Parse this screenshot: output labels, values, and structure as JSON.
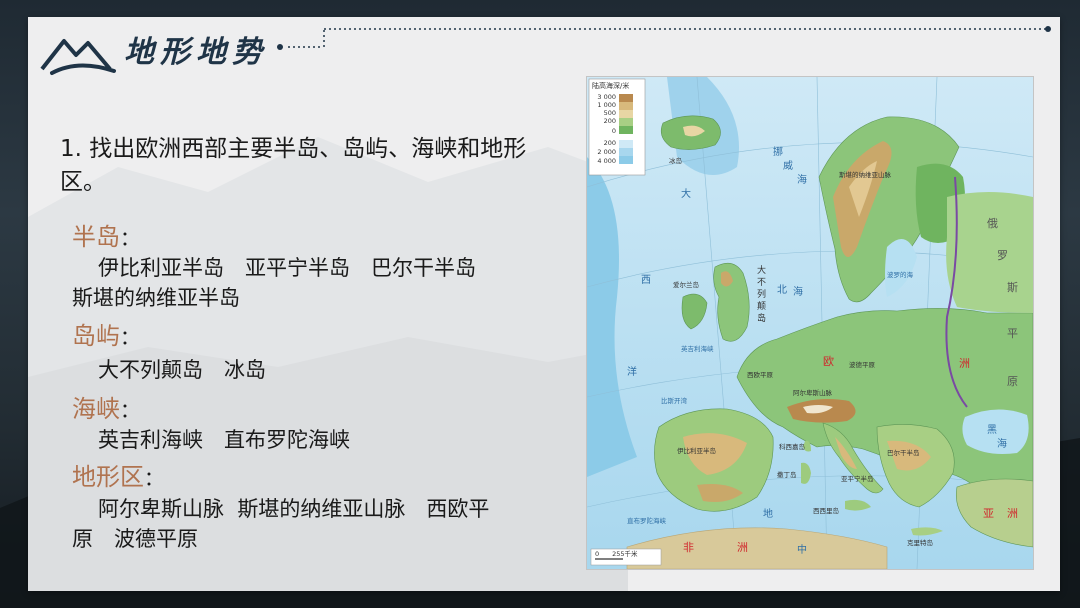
{
  "header": {
    "title": "地形地势"
  },
  "question": {
    "text": "1. 找出欧洲西部主要半岛、岛屿、海峡和地形区。"
  },
  "sections": [
    {
      "label": "半岛",
      "colon": "：",
      "lines": [
        "伊比利亚半岛　亚平宁半岛　巴尔干半岛",
        "斯堪的纳维亚半岛"
      ]
    },
    {
      "label": "岛屿",
      "colon": "：",
      "lines": [
        "大不列颠岛　冰岛"
      ]
    },
    {
      "label": "海峡",
      "colon": "：",
      "lines": [
        "英吉利海峡　直布罗陀海峡"
      ]
    },
    {
      "label": "地形区",
      "colon": "：",
      "lines": [
        "阿尔卑斯山脉  斯堪的纳维亚山脉　西欧平",
        "原　波德平原"
      ]
    }
  ],
  "map": {
    "legend_title": "陆高海深/米",
    "legend_levels": [
      "3 000",
      "1 000",
      "500",
      "200",
      "0",
      "200",
      "2 000",
      "4 000"
    ],
    "scale_text": "0　　255千米",
    "labels": {
      "atlantic_1": "大",
      "atlantic_2": "西",
      "atlantic_3": "洋",
      "north_sea_1": "北",
      "north_sea_2": "海",
      "mediterranean_1": "地",
      "mediterranean_2": "中",
      "africa_1": "非",
      "africa_2": "洲",
      "asia_1": "亚",
      "asia_2": "洲",
      "europe_1": "欧",
      "europe_2": "洲",
      "russia_1": "俄",
      "russia_2": "罗",
      "russia_3": "斯",
      "plain_1": "平",
      "plain_2": "原",
      "britain_1": "大",
      "britain_2": "不",
      "britain_3": "列",
      "britain_4": "颠",
      "britain_5": "岛",
      "iberia": "伊比利亚半岛",
      "norway_sea_1": "挪",
      "norway_sea_2": "威",
      "norway_sea_3": "海",
      "baltic": "波罗的海",
      "polish_plain": "波德平原",
      "west_plain": "西欧平原",
      "biscay": "比斯开湾",
      "alps": "阿尔卑斯山脉",
      "apennine": "亚平宁半岛",
      "balkan": "巴尔干半岛",
      "black_sea_1": "黑",
      "black_sea_2": "海",
      "sicily": "西西里岛",
      "sardinia": "撒丁岛",
      "corsica": "科西嘉岛",
      "crete": "克里特岛",
      "gibraltar": "直布罗陀海峡",
      "channel": "英吉利海峡",
      "iceland": "冰岛",
      "ireland": "爱尔兰岛",
      "scandinavia": "斯堪的纳维亚山脉"
    }
  }
}
